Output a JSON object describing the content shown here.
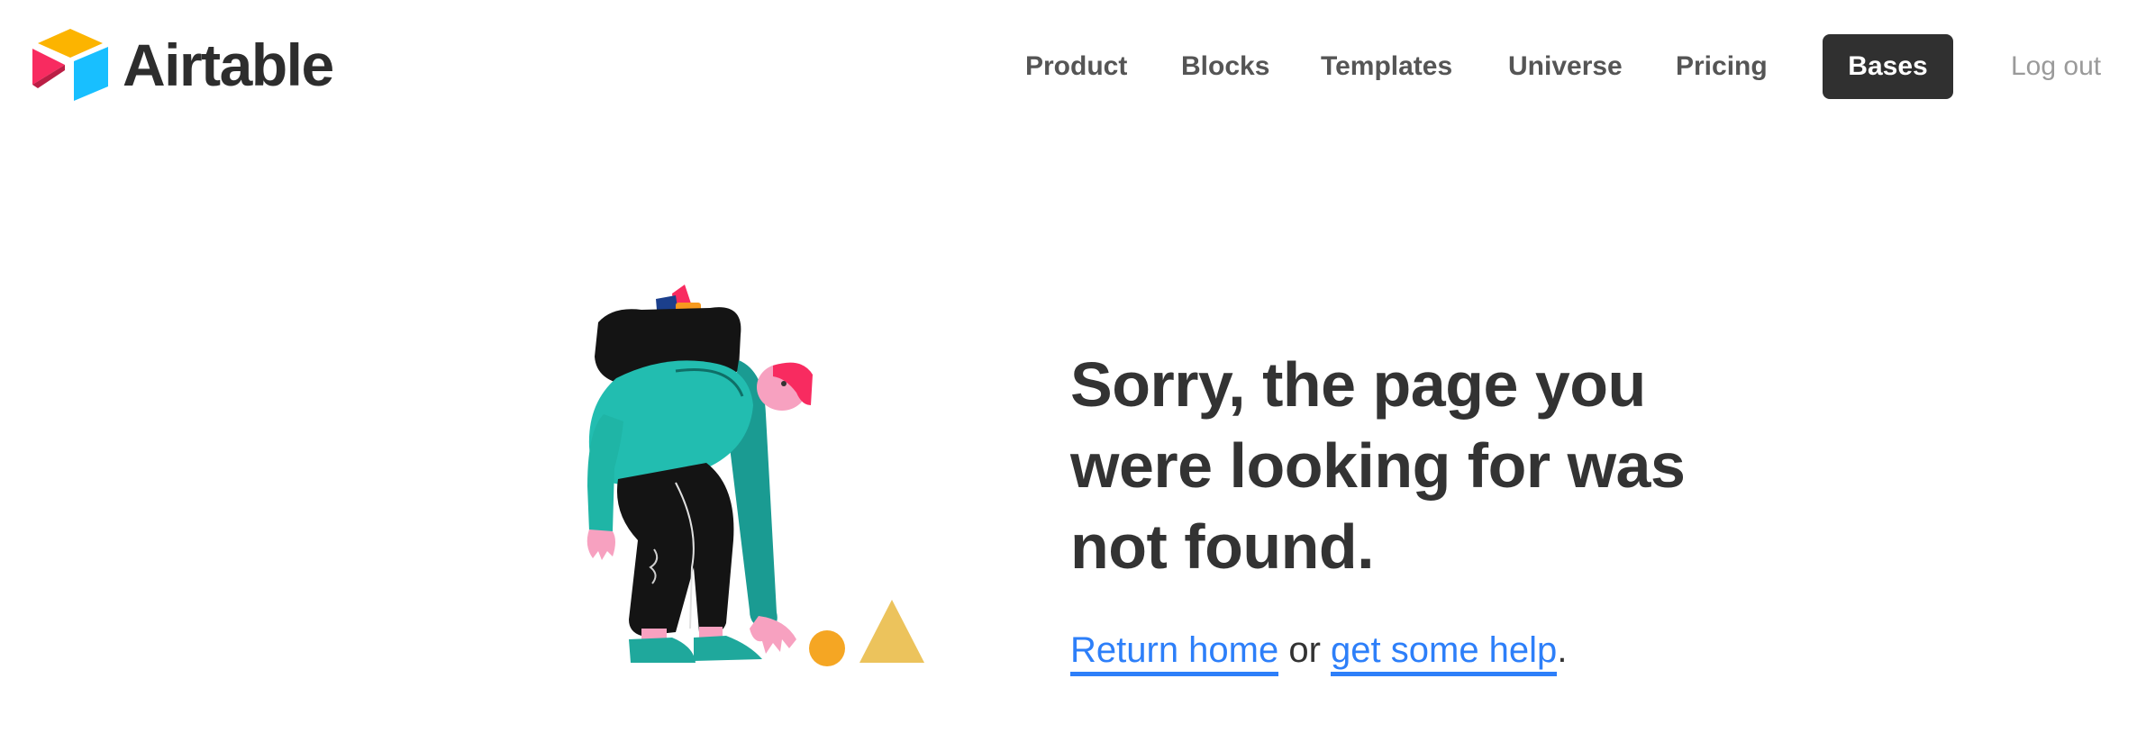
{
  "header": {
    "brand": "Airtable",
    "nav": {
      "product": "Product",
      "blocks": "Blocks",
      "templates": "Templates",
      "universe": "Universe",
      "pricing": "Pricing",
      "bases": "Bases",
      "logout": "Log out"
    }
  },
  "error": {
    "title": "Sorry, the page you were looking for was not found.",
    "return_home": "Return home",
    "or": " or ",
    "get_help": "get some help",
    "period": "."
  },
  "colors": {
    "link": "#2d7ff9",
    "primary_button": "#303030",
    "logo_yellow": "#fcb400",
    "logo_blue": "#18bfff",
    "logo_red": "#f82b60",
    "figure_teal": "#1fb5a6"
  },
  "icons": {
    "logo": "airtable-logo-icon",
    "illustration": "lost-person-illustration"
  }
}
